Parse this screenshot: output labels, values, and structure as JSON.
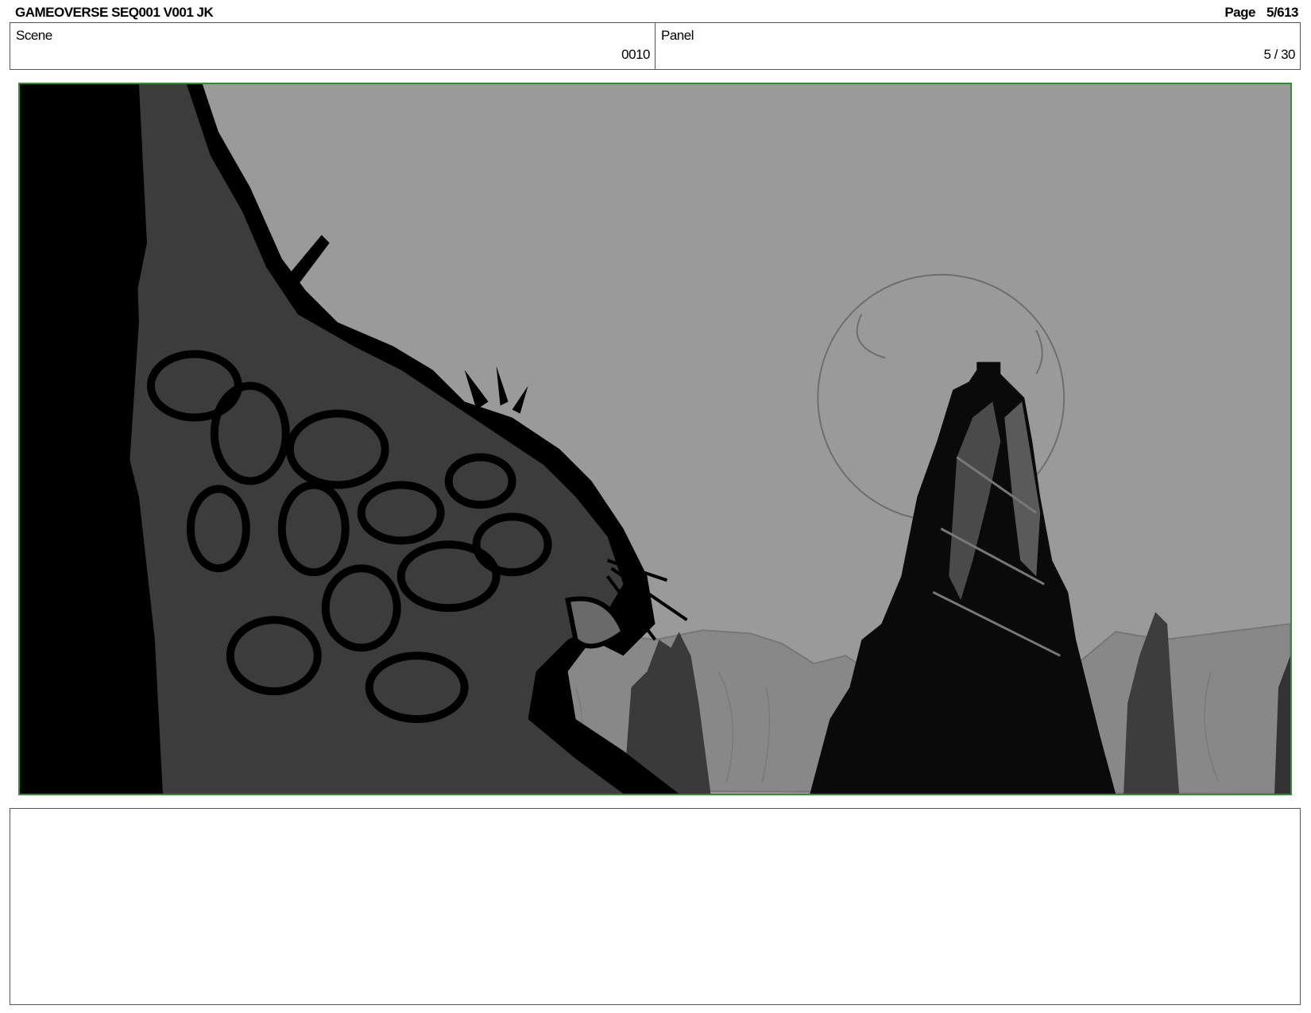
{
  "header": {
    "title": "GAMEOVERSE SEQ001 V001 JK",
    "page_label": "Page",
    "page_value": "5/613"
  },
  "info": {
    "scene_label": "Scene",
    "scene_value": "0010",
    "panel_label": "Panel",
    "panel_value": "5 / 30"
  },
  "frame": {
    "border_color": "#3a8a3a",
    "sky_color": "#9a9a9a",
    "description_icon": "storyboard-sketch"
  },
  "notes": {
    "text": ""
  }
}
